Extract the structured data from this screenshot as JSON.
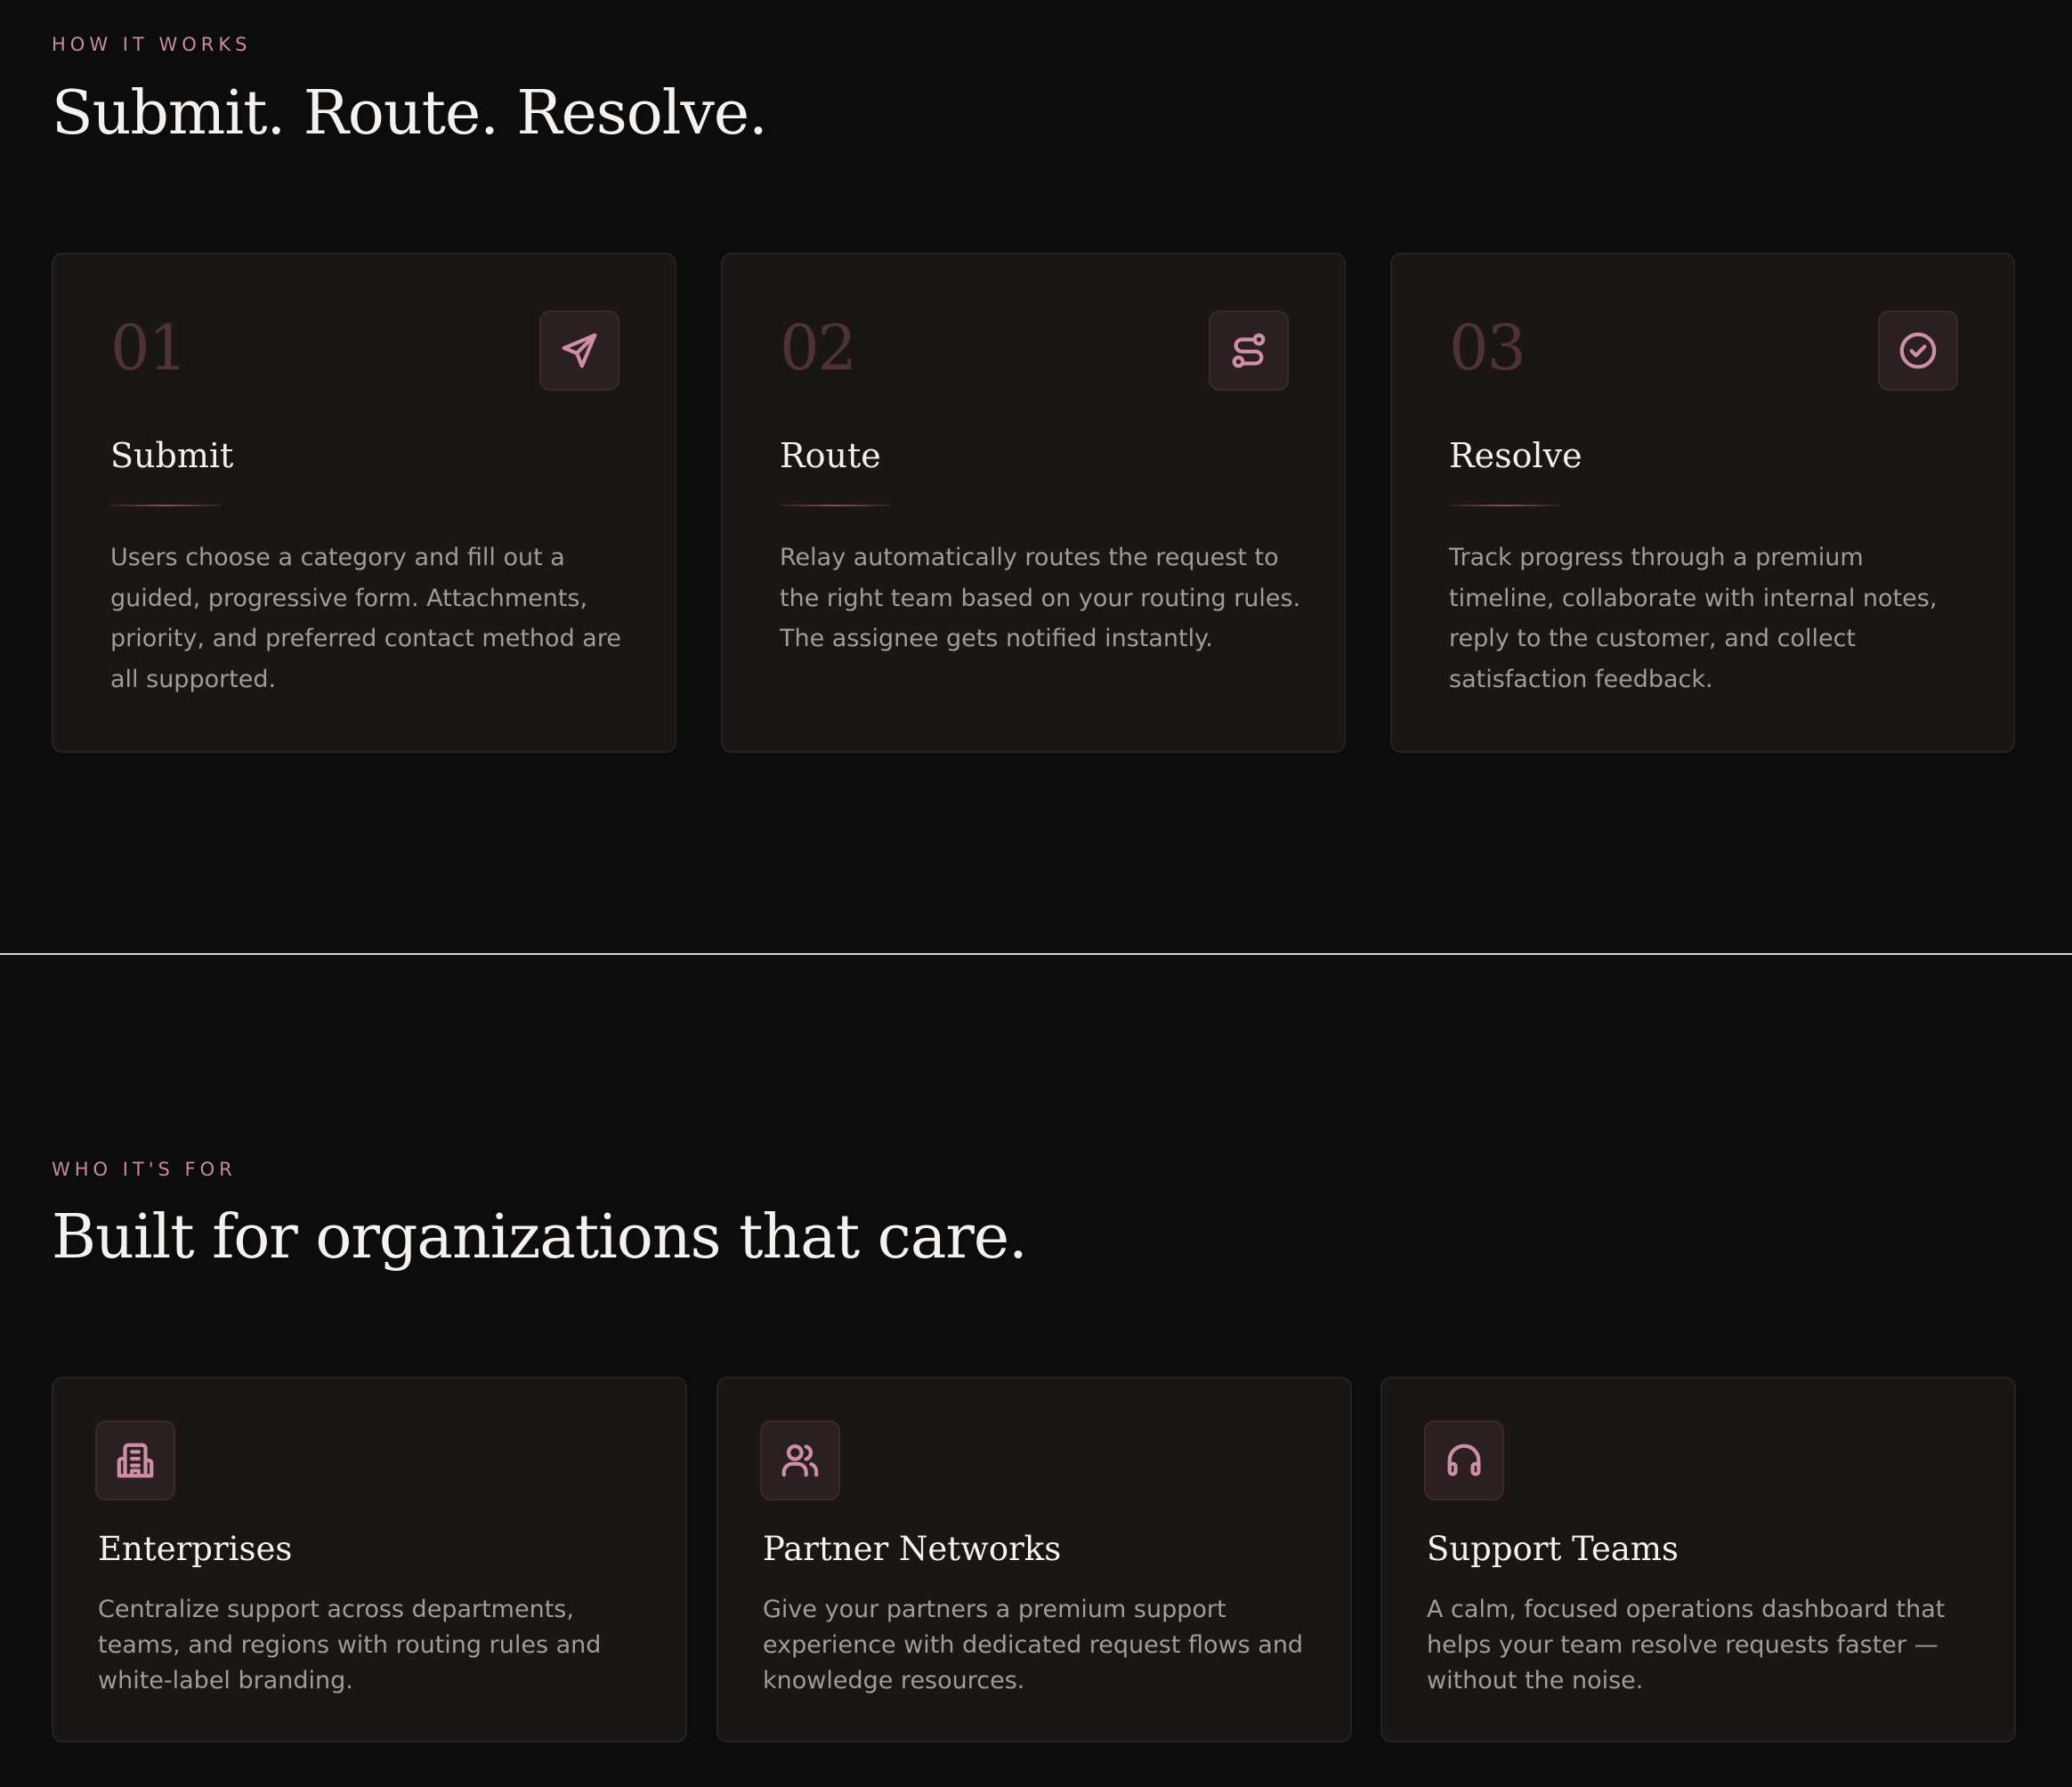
{
  "how_it_works": {
    "eyebrow": "HOW IT WORKS",
    "headline": "Submit. Route. Resolve.",
    "steps": [
      {
        "number": "01",
        "icon": "send-icon",
        "title": "Submit",
        "description": "Users choose a category and fill out a guided, progressive form. Attachments, priority, and preferred contact method are all supported."
      },
      {
        "number": "02",
        "icon": "route-icon",
        "title": "Route",
        "description": "Relay automatically routes the request to the right team based on your routing rules. The assignee gets notified instantly."
      },
      {
        "number": "03",
        "icon": "check-circle-icon",
        "title": "Resolve",
        "description": "Track progress through a premium timeline, collaborate with internal notes, reply to the customer, and collect satisfaction feedback."
      }
    ]
  },
  "who_its_for": {
    "eyebrow": "WHO IT'S FOR",
    "headline": "Built for organizations that care.",
    "audiences": [
      {
        "icon": "building-icon",
        "title": "Enterprises",
        "description": "Centralize support across departments, teams, and regions with routing rules and white-label branding."
      },
      {
        "icon": "users-icon",
        "title": "Partner Networks",
        "description": "Give your partners a premium support experience with dedicated request flows and knowledge resources."
      },
      {
        "icon": "headphones-icon",
        "title": "Support Teams",
        "description": "A calm, focused operations dashboard that helps your team resolve requests faster — without the noise."
      }
    ]
  },
  "colors": {
    "background": "#0c0c0c",
    "card": "#1a1614",
    "accent": "#c98a9f",
    "step_number": "#4d3338",
    "body_text": "#a29c98"
  }
}
